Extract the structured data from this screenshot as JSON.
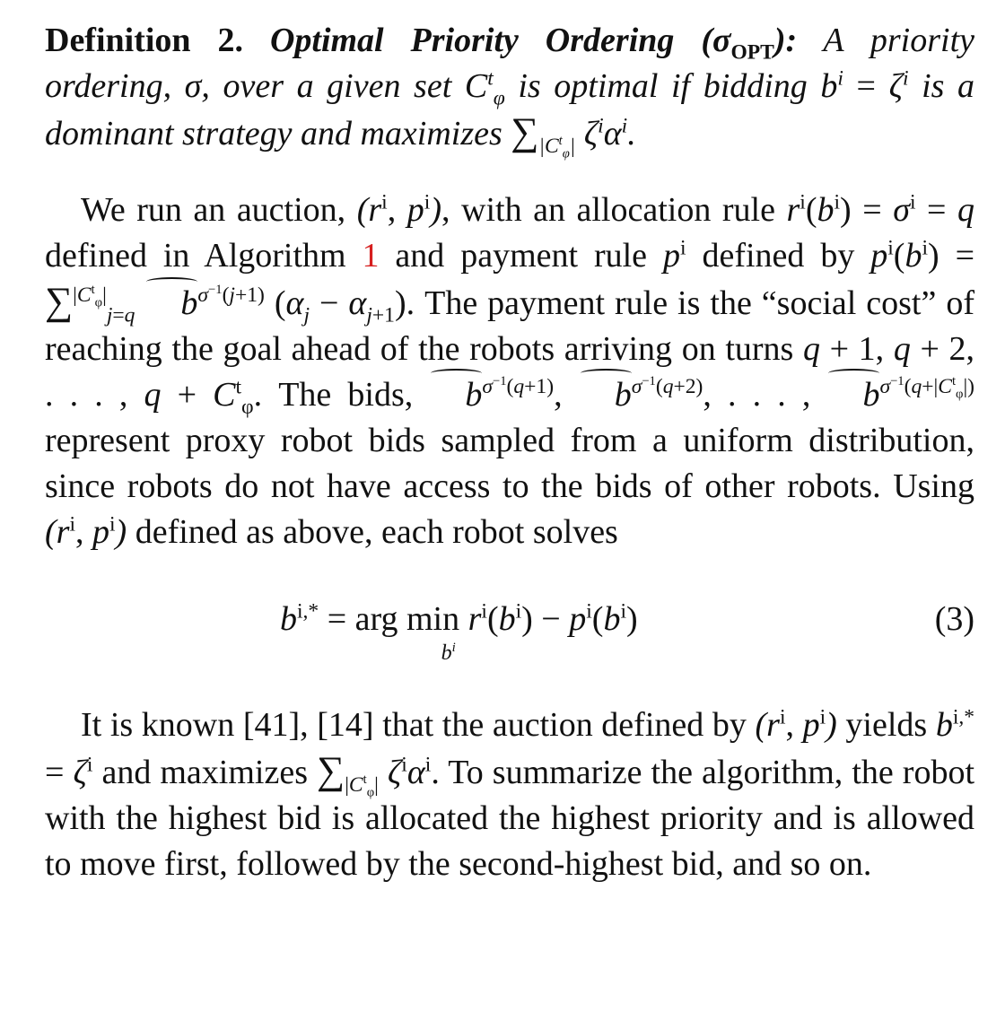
{
  "definition": {
    "label": "Definition 2.",
    "title": "Optimal Priority Ordering (σOPT):",
    "text": "A priority ordering, σ, over a given set Ctφ is optimal if bidding bi = ζi is a dominant strategy and maximizes ∑|Ctφ| ζiαi."
  },
  "paragraph1": {
    "text": "We run an auction, (ri, pi), with an allocation rule ri(bi) = σi = q defined in Algorithm 1 and payment rule pi defined by pi(bi) = ∑|Ctφ|j=q b̂σ−1(j+1) (αj − αj+1). The payment rule is the “social cost” of reaching the goal ahead of the robots arriving on turns q + 1, q + 2, . . . , q + Ctφ. The bids, b̂σ−1(q+1), b̂σ−1(q+2), . . . , b̂σ−1(q+|Ctφ|) represent proxy robot bids sampled from a uniform distribution, since robots do not have access to the bids of other robots. Using (ri, pi) defined as above, each robot solves",
    "algorithm_ref": "1"
  },
  "equation": {
    "expression": "bi,* = arg min r(bi) − pi(bi)",
    "subscript": "bi",
    "number": "(3)"
  },
  "paragraph2": {
    "text": "It is known [41], [14] that the auction defined by (ri, pi) yields bi,* = ζi and maximizes ∑|Ctφ| ζiαi. To summarize the algorithm, the robot with the highest bid is allocated the highest priority and is allowed to move first, followed by the second-highest bid, and so on."
  }
}
